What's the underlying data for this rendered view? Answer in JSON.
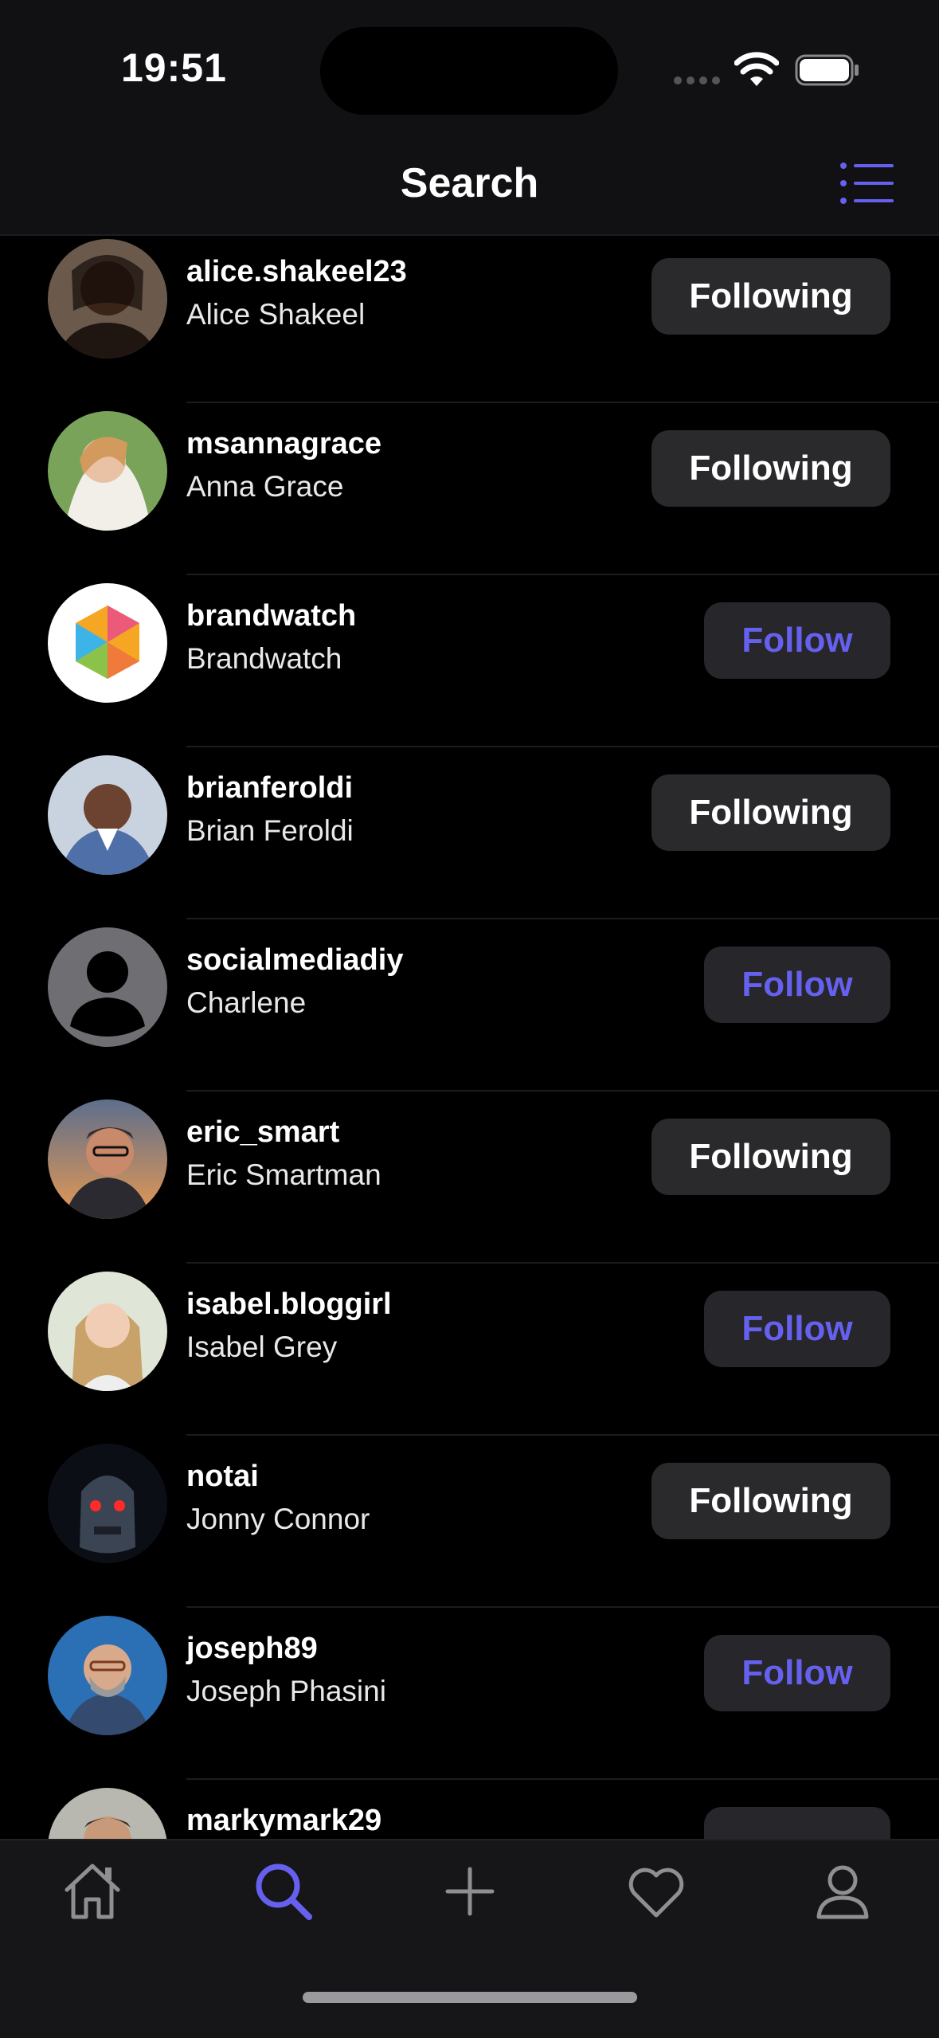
{
  "status_bar": {
    "time": "19:51"
  },
  "nav": {
    "title": "Search"
  },
  "users": [
    {
      "username": "alice.shakeel23",
      "name": "Alice Shakeel",
      "button": "Following",
      "state": "following",
      "avatar": "photo"
    },
    {
      "username": "msannagrace",
      "name": "Anna Grace",
      "button": "Following",
      "state": "following",
      "avatar": "photo"
    },
    {
      "username": "brandwatch",
      "name": "Brandwatch",
      "button": "Follow",
      "state": "follow",
      "avatar": "brandwatch-logo"
    },
    {
      "username": "brianferoldi",
      "name": "Brian Feroldi",
      "button": "Following",
      "state": "following",
      "avatar": "photo"
    },
    {
      "username": "socialmediadiy",
      "name": "Charlene",
      "button": "Follow",
      "state": "follow",
      "avatar": "default-person"
    },
    {
      "username": "eric_smart",
      "name": "Eric Smartman",
      "button": "Following",
      "state": "following",
      "avatar": "photo"
    },
    {
      "username": "isabel.bloggirl",
      "name": "Isabel Grey",
      "button": "Follow",
      "state": "follow",
      "avatar": "photo"
    },
    {
      "username": "notai",
      "name": "Jonny Connor",
      "button": "Following",
      "state": "following",
      "avatar": "robot-photo"
    },
    {
      "username": "joseph89",
      "name": "Joseph Phasini",
      "button": "Follow",
      "state": "follow",
      "avatar": "photo"
    },
    {
      "username": "markymark29",
      "name": "",
      "button": "",
      "state": "follow",
      "avatar": "photo"
    }
  ],
  "tabs": [
    {
      "icon": "house-icon",
      "active": false
    },
    {
      "icon": "search-icon",
      "active": true
    },
    {
      "icon": "plus-icon",
      "active": false
    },
    {
      "icon": "heart-icon",
      "active": false
    },
    {
      "icon": "person-icon",
      "active": false
    }
  ],
  "colors": {
    "accent": "#6660ee",
    "background": "#000000",
    "button_bg": "#2a2a2d",
    "inactive_icon": "#8e8e93"
  }
}
